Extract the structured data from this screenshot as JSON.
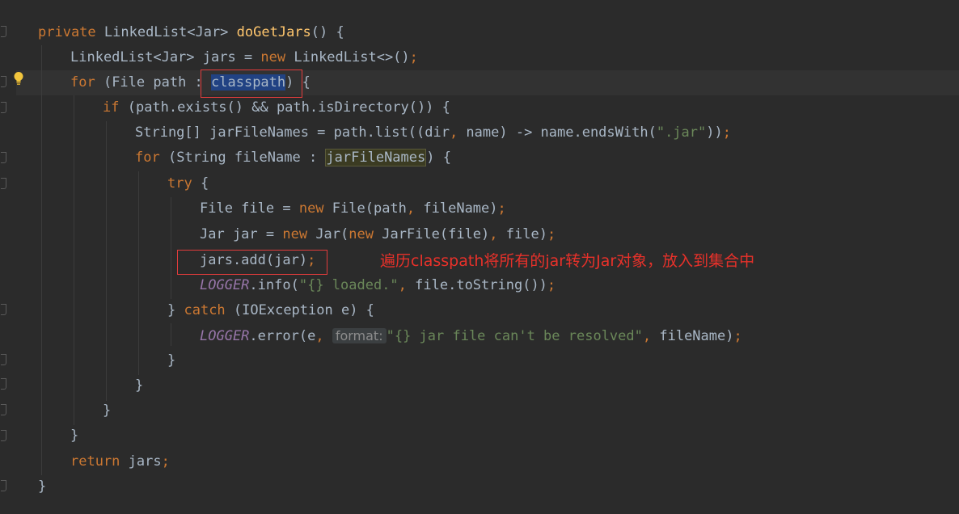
{
  "code": {
    "l1": {
      "kw": "private",
      "t1": " LinkedList<Jar> ",
      "fn": "doGetJars",
      "t2": "() {"
    },
    "l2": {
      "t1": "LinkedList<Jar> jars = ",
      "kw": "new",
      "t2": " LinkedList<>()",
      "semi": ";"
    },
    "l3": {
      "kw": "for",
      "t1": " (File path : ",
      "sel": "classpath",
      "t2": ") {"
    },
    "l4": {
      "kw": "if",
      "t1": " (path.exists() && path.isDirectory()) {"
    },
    "l5": {
      "t1": "String[] jarFileNames = path.list((dir",
      "c1": ",",
      "t2": " name) -> name.endsWith(",
      "str": "\".jar\"",
      "t3": "))",
      "semi": ";"
    },
    "l6": {
      "kw": "for",
      "t1": " (String fileName : ",
      "hl": "jarFileNames",
      "t2": ") {"
    },
    "l7": {
      "kw": "try",
      "t1": " {"
    },
    "l8": {
      "t1": "File file = ",
      "kw": "new",
      "t2": " File(path",
      "c1": ",",
      "t3": " fileName)",
      "semi": ";"
    },
    "l9": {
      "t1": "Jar jar = ",
      "kw": "new",
      "t2": " Jar(",
      "kw2": "new",
      "t3": " JarFile(file)",
      "c1": ",",
      "t4": " file)",
      "semi": ";"
    },
    "l10": {
      "t1": "jars.add(jar)",
      "semi": ";"
    },
    "l11": {
      "log": "LOGGER",
      "t1": ".info(",
      "str": "\"{} loaded.\"",
      "c1": ",",
      "t2": " file.toString())",
      "semi": ";"
    },
    "l12": {
      "t1": "} ",
      "kw": "catch",
      "t2": " (IOException e) {"
    },
    "l13": {
      "log": "LOGGER",
      "t1": ".error(e",
      "c1": ",",
      "hint": "format:",
      "str": "\"{} jar file can't be resolved\"",
      "c2": ",",
      "t2": " fileName)",
      "semi": ";"
    },
    "l14": "}",
    "l15": "}",
    "l16": "}",
    "l17": "}",
    "l18": {
      "kw": "return",
      "t1": " jars",
      "semi": ";"
    },
    "l19": "}"
  },
  "annotation": "遍历classpath将所有的jar转为Jar对象，放入到集合中",
  "colors": {
    "background": "#2b2b2b",
    "keyword": "#cc7832",
    "method": "#ffc66d",
    "string": "#6a8759",
    "field": "#9876aa",
    "annotation": "#e8312a"
  },
  "icons": [
    "lightbulb-icon",
    "fold-marker-icon"
  ]
}
